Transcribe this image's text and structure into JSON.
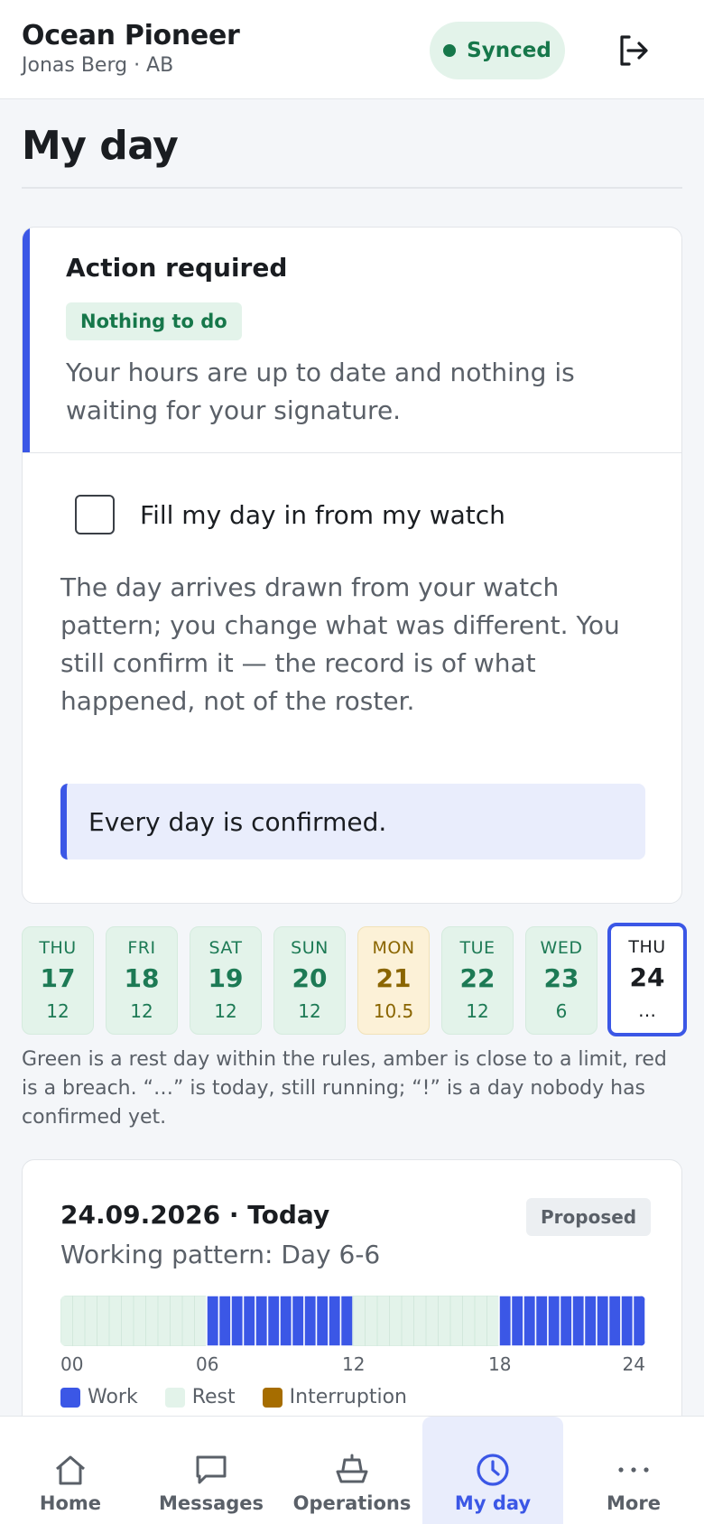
{
  "header": {
    "vessel": "Ocean Pioneer",
    "user": "Jonas Berg · AB",
    "sync_label": "Synced",
    "logout_icon": "logout-icon"
  },
  "page": {
    "title": "My day"
  },
  "action": {
    "title": "Action required",
    "badge": "Nothing to do",
    "description": "Your hours are up to date and nothing is waiting for your signature.",
    "checkbox_label": "Fill my day in from my watch",
    "checkbox_checked": false,
    "watch_description": "The day arrives drawn from your watch pattern; you change what was different. You still confirm it — the record is of what happened, not of the roster.",
    "banner": "Every day is confirmed."
  },
  "days": [
    {
      "dow": "THU",
      "day": "17",
      "hours": "12",
      "status": "green"
    },
    {
      "dow": "FRI",
      "day": "18",
      "hours": "12",
      "status": "green"
    },
    {
      "dow": "SAT",
      "day": "19",
      "hours": "12",
      "status": "green"
    },
    {
      "dow": "SUN",
      "day": "20",
      "hours": "12",
      "status": "green"
    },
    {
      "dow": "MON",
      "day": "21",
      "hours": "10.5",
      "status": "amber"
    },
    {
      "dow": "TUE",
      "day": "22",
      "hours": "12",
      "status": "green"
    },
    {
      "dow": "WED",
      "day": "23",
      "hours": "6",
      "status": "green"
    },
    {
      "dow": "THU",
      "day": "24",
      "hours": "…",
      "status": "today"
    }
  ],
  "legend_note": "Green is a rest day within the rules, amber is close to a limit, red is a breach. “…” is today, still running; “!” is a day nobody has confirmed yet.",
  "day_card": {
    "date": "24.09.2026 · Today",
    "badge": "Proposed",
    "pattern": "Working pattern: Day 6-6",
    "ticks": [
      "00",
      "06",
      "12",
      "18",
      "24"
    ],
    "work_periods": [
      [
        6,
        12
      ],
      [
        18,
        24
      ]
    ],
    "legend": [
      {
        "label": "Work",
        "color": "#3b57e6"
      },
      {
        "label": "Rest",
        "color": "#e3f3ea"
      },
      {
        "label": "Interruption",
        "color": "#a66d00"
      }
    ]
  },
  "nav": [
    {
      "label": "Home",
      "icon": "home-icon"
    },
    {
      "label": "Messages",
      "icon": "messages-icon"
    },
    {
      "label": "Operations",
      "icon": "ship-icon"
    },
    {
      "label": "My day",
      "icon": "clock-icon",
      "active": true
    },
    {
      "label": "More",
      "icon": "more-icon"
    }
  ],
  "colors": {
    "accent": "#3b57e6",
    "green": "#16774a",
    "amber": "#8a6500"
  }
}
